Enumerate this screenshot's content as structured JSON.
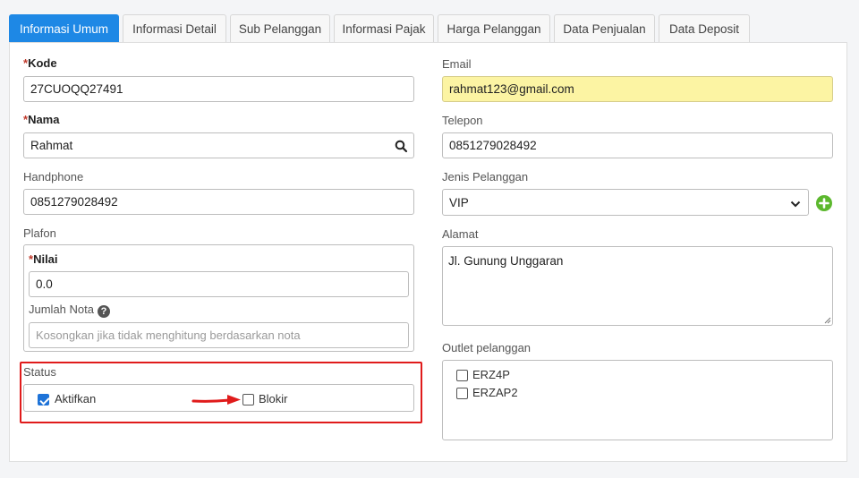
{
  "tabs": [
    {
      "label": "Informasi Umum",
      "active": true
    },
    {
      "label": "Informasi Detail",
      "active": false
    },
    {
      "label": "Sub Pelanggan",
      "active": false
    },
    {
      "label": "Informasi Pajak",
      "active": false
    },
    {
      "label": "Harga Pelanggan",
      "active": false
    },
    {
      "label": "Data Penjualan",
      "active": false
    },
    {
      "label": "Data Deposit",
      "active": false
    }
  ],
  "form": {
    "kode": {
      "label": "Kode",
      "value": "27CUOQQ27491",
      "required": "*"
    },
    "nama": {
      "label": "Nama",
      "value": "Rahmat",
      "required": "*"
    },
    "handphone": {
      "label": "Handphone",
      "value": "0851279028492"
    },
    "plafon": {
      "label": "Plafon",
      "nilai": {
        "label": "Nilai",
        "value": "0.0",
        "required": "*"
      },
      "jumlah_nota": {
        "label": "Jumlah Nota",
        "placeholder": "Kosongkan jika tidak menghitung berdasarkan nota",
        "help_icon": "?"
      }
    },
    "status": {
      "label": "Status",
      "aktifkan": {
        "label": "Aktifkan",
        "checked": true
      },
      "blokir": {
        "label": "Blokir",
        "checked": false
      }
    },
    "email": {
      "label": "Email",
      "value": "rahmat123@gmail.com"
    },
    "telepon": {
      "label": "Telepon",
      "value": "0851279028492"
    },
    "jenis_pelanggan": {
      "label": "Jenis Pelanggan",
      "value": "VIP"
    },
    "alamat": {
      "label": "Alamat",
      "value": "Jl. Gunung Unggaran"
    },
    "outlet": {
      "label": "Outlet pelanggan",
      "items": [
        {
          "label": "ERZ4P",
          "checked": false
        },
        {
          "label": "ERZAP2",
          "checked": false
        }
      ]
    }
  },
  "colors": {
    "accent": "#1e88e5",
    "highlight_email": "#fcf4a3",
    "annotation_red": "#e01b1b",
    "add_green": "#5cb82e"
  },
  "icons": [
    "search-icon",
    "help-icon",
    "chevron-down-icon",
    "plus-icon",
    "arrow-annotation"
  ]
}
